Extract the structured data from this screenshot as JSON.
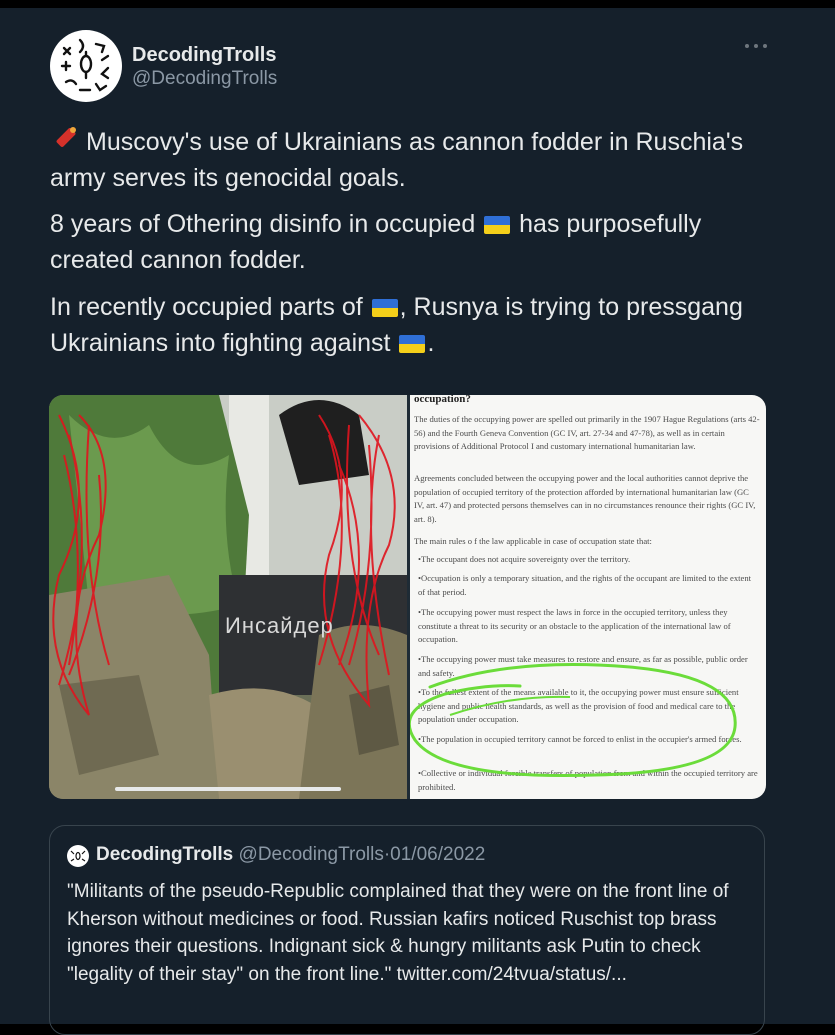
{
  "tweet": {
    "display_name": "DecodingTrolls",
    "handle": "@DecodingTrolls",
    "avatar_icon": "ornament-avatar-icon",
    "more_icon": "more-options-icon",
    "paragraphs": [
      {
        "pre": "Muscovy's use of Ukrainians as cannon fodder in Ruschia's army serves its genocidal goals.",
        "lead_icon": "firecracker-icon"
      },
      {
        "pre": "8 years of Othering disinfo in occupied",
        "post": "has purposefully created cannon fodder.",
        "flag_icon": "ukraine-flag-icon"
      },
      {
        "pre": "In recently occupied parts of",
        "mid": ", Rusnya is trying to pressgang Ukrainians into fighting against",
        "post": ".",
        "flag_icon": "ukraine-flag-icon"
      }
    ]
  },
  "media": {
    "photo_overlay_text": "Инсайдер",
    "document": {
      "heading": "occupation?",
      "paragraphs": [
        "The duties of the occupying power are spelled out primarily in the 1907 Hague Regulations (arts 42-56) and the Fourth Geneva Convention (GC IV, art. 27-34 and 47-78), as well as in certain provisions of Additional Protocol I and customary international humanitarian law.",
        "Agreements concluded between the occupying power and the local authorities cannot deprive the population of occupied territory of the protection afforded by international humanitarian law (GC IV, art. 47) and protected persons themselves can in no circumstances renounce their rights (GC IV, art. 8).",
        "The main rules o f the law applicable in case of occupation state that:",
        "•The occupant does not acquire sovereignty over the territory.",
        "•Occupation is only a temporary situation, and the rights of the occupant are limited to the extent of that period.",
        "•The occupying power must respect the laws in force in the occupied territory, unless they constitute a threat to its security or an obstacle to the application of the international law of occupation.",
        "•The occupying power must take measures to restore and ensure, as far as possible, public order and safety.",
        "•To the fullest extent of the means available to it, the occupying power must ensure sufficient hygiene and public health standards, as well as the provision of food and medical care to the population under occupation.",
        "•The population in occupied territory cannot be forced to enlist in the occupier's armed forces.",
        "•Collective or individual forcible transfers of population from and within the occupied territory are prohibited."
      ]
    }
  },
  "quoted_tweet": {
    "display_name": "DecodingTrolls",
    "handle": "@DecodingTrolls",
    "separator": "·",
    "date": "01/06/2022",
    "text": "\"Militants of the pseudo-Republic complained that they were on the front line of Kherson without medicines or food. Russian kafirs noticed Ruschist top brass ignores their questions. Indignant sick & hungry militants ask Putin to check \"legality of their stay\" on the front line.\" twitter.com/24tvua/status/..."
  },
  "colors": {
    "background": "#15202b",
    "text": "#e7e9ea",
    "secondary_text": "#8b98a5",
    "border": "#38444d",
    "highlight_green": "#6bdc3a",
    "scribble_red": "#e0141e"
  }
}
